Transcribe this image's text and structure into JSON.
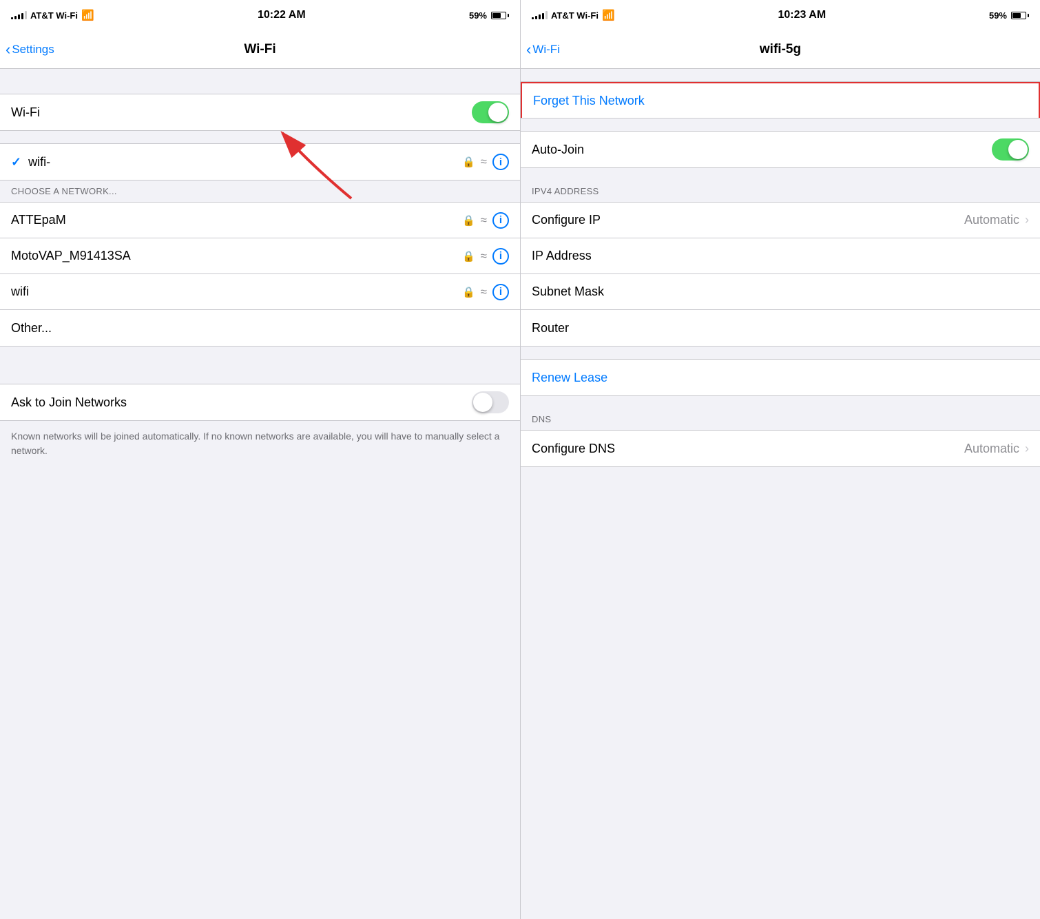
{
  "left_panel": {
    "status_bar": {
      "carrier": "AT&T Wi-Fi",
      "time": "10:22 AM",
      "battery": "59%"
    },
    "nav": {
      "back_label": "Settings",
      "title": "Wi-Fi"
    },
    "wifi_row": {
      "label": "Wi-Fi",
      "enabled": true
    },
    "connected_network": {
      "name": "wifi-",
      "checkmark": "✓"
    },
    "section_header": "CHOOSE A NETWORK...",
    "networks": [
      {
        "name": "ATTEpaM"
      },
      {
        "name": "MotoVAP_M91413SA"
      },
      {
        "name": "wifi"
      }
    ],
    "other_label": "Other...",
    "ask_join": {
      "label": "Ask to Join Networks",
      "enabled": false
    },
    "footer": "Known networks will be joined automatically. If no known networks are available, you will have to manually select a network."
  },
  "right_panel": {
    "status_bar": {
      "carrier": "AT&T Wi-Fi",
      "time": "10:23 AM",
      "battery": "59%"
    },
    "nav": {
      "back_label": "Wi-Fi",
      "title": "wifi-5g"
    },
    "forget_label": "Forget This Network",
    "auto_join": {
      "label": "Auto-Join",
      "enabled": true
    },
    "ipv4_section": "IPV4 ADDRESS",
    "configure_ip": {
      "label": "Configure IP",
      "value": "Automatic"
    },
    "ip_address": {
      "label": "IP Address",
      "value": ""
    },
    "subnet_mask": {
      "label": "Subnet Mask",
      "value": ""
    },
    "router": {
      "label": "Router",
      "value": ""
    },
    "renew_lease": "Renew Lease",
    "dns_section": "DNS",
    "configure_dns": {
      "label": "Configure DNS",
      "value": "Automatic"
    }
  },
  "icons": {
    "lock": "🔒",
    "wifi": "📶",
    "info": "ⓘ",
    "chevron_right": "›",
    "chevron_left": "‹",
    "check": "✓"
  }
}
